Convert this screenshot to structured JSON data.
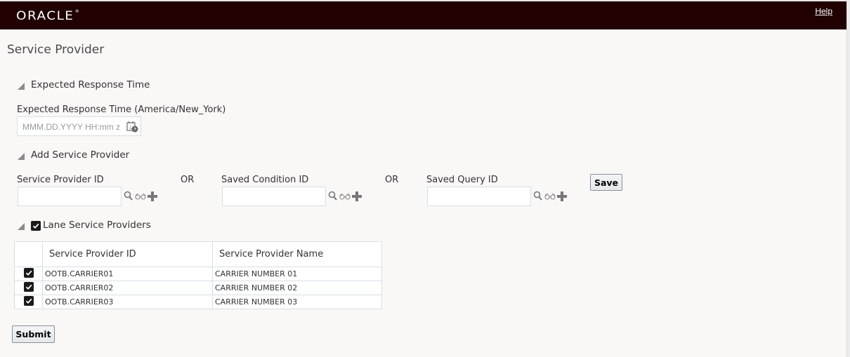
{
  "header": {
    "logo": "ORACLE",
    "logo_mark": "®",
    "help_link": "Help",
    "background_color": "#200000"
  },
  "page": {
    "title": "Service Provider"
  },
  "expected_response_time": {
    "section_title": "Expected Response Time",
    "field_label": "Expected Response Time (America/New_York)",
    "placeholder": "MMM.DD.YYYY HH:mm z",
    "value": "",
    "icon": "calendar-clock-icon"
  },
  "add_service_provider": {
    "section_title": "Add Service Provider",
    "or_label": "OR",
    "fields": [
      {
        "label": "Service Provider ID",
        "value": "",
        "icons": [
          "search-icon",
          "glasses-icon",
          "plus-icon"
        ]
      },
      {
        "label": "Saved Condition ID",
        "value": "",
        "icons": [
          "search-icon",
          "glasses-icon",
          "plus-icon"
        ]
      },
      {
        "label": "Saved Query ID",
        "value": "",
        "icons": [
          "search-icon",
          "glasses-icon",
          "plus-icon"
        ]
      }
    ],
    "save_button": "Save"
  },
  "lane_service_providers": {
    "section_title": "Lane Service Providers",
    "select_all_checked": true,
    "columns": [
      "Service Provider ID",
      "Service Provider Name"
    ],
    "rows": [
      {
        "checked": true,
        "id": "OOTB.CARRIER01",
        "name": "CARRIER NUMBER 01"
      },
      {
        "checked": true,
        "id": "OOTB.CARRIER02",
        "name": "CARRIER NUMBER 02"
      },
      {
        "checked": true,
        "id": "OOTB.CARRIER03",
        "name": "CARRIER NUMBER 03"
      }
    ]
  },
  "footer": {
    "submit_button": "Submit"
  }
}
